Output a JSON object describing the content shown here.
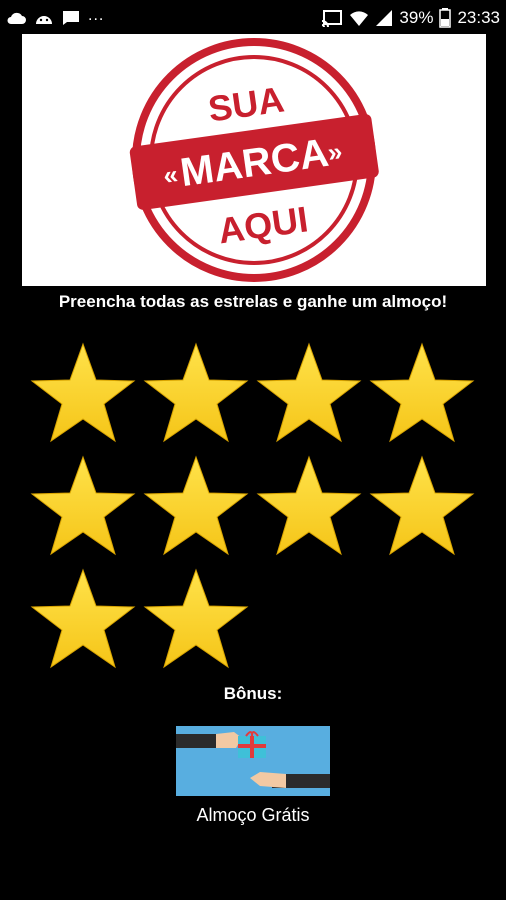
{
  "status_bar": {
    "icons_left": [
      "cloud-icon",
      "android-icon",
      "message-icon"
    ],
    "overflow": "...",
    "icons_right": [
      "cast-icon",
      "wifi-icon",
      "signal-icon"
    ],
    "battery": "39%",
    "time": "23:33"
  },
  "banner": {
    "top_text": "SUA",
    "middle_text": "MARCA",
    "bottom_text": "AQUI",
    "accent_color": "#c8202e"
  },
  "promo": {
    "text": "Preencha todas as estrelas e ganhe um almoço!"
  },
  "stars": {
    "total": 10,
    "filled": 10,
    "color": "#f5c518"
  },
  "bonus": {
    "label": "Bônus:",
    "caption": "Almoço Grátis",
    "card_bg": "#58aee0"
  }
}
